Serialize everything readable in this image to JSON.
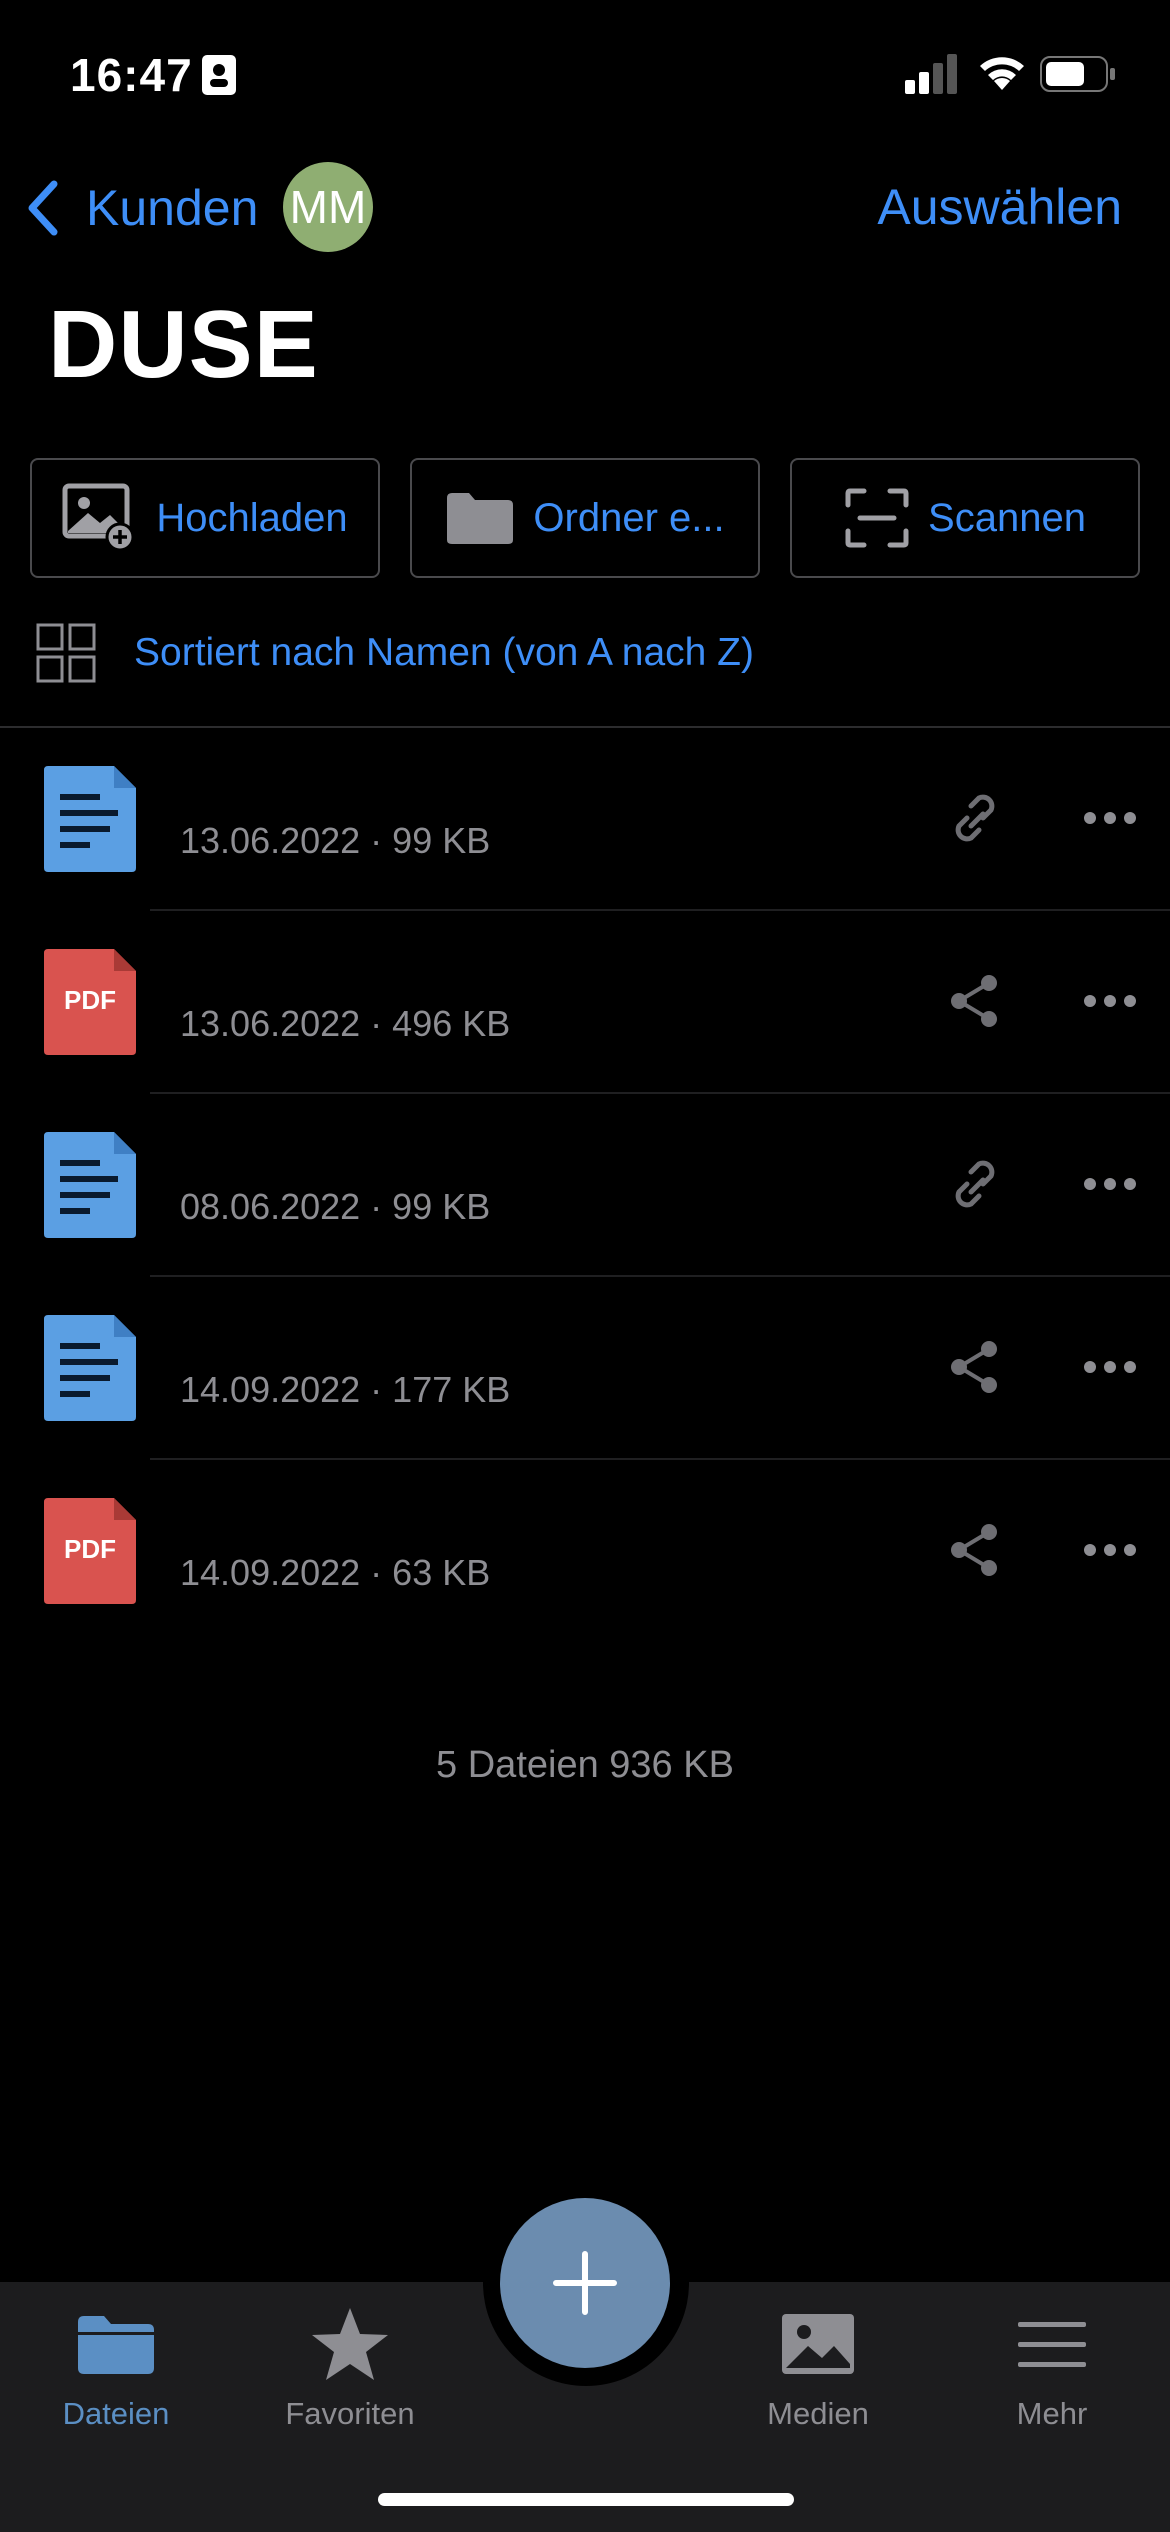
{
  "status_bar": {
    "time": "16:47"
  },
  "nav": {
    "back_label": "Kunden",
    "avatar_initials": "MM",
    "select_label": "Auswählen"
  },
  "title": "DUSE",
  "actions": {
    "upload": "Hochladen",
    "folder": "Ordner e...",
    "scan": "Scannen"
  },
  "sort_label": "Sortiert nach Namen (von A nach Z)",
  "files": [
    {
      "type": "doc",
      "name": "",
      "meta": "13.06.2022 · 99 KB",
      "action_icon": "link-icon"
    },
    {
      "type": "pdf",
      "name": "",
      "meta": "13.06.2022 · 496 KB",
      "action_icon": "share-icon",
      "icon_label": "PDF"
    },
    {
      "type": "doc",
      "name": "",
      "meta": "08.06.2022 · 99 KB",
      "action_icon": "link-icon"
    },
    {
      "type": "doc",
      "name": "",
      "meta": "14.09.2022 · 177 KB",
      "action_icon": "share-icon"
    },
    {
      "type": "pdf",
      "name": "",
      "meta": "14.09.2022 · 63 KB",
      "action_icon": "share-icon",
      "icon_label": "PDF"
    }
  ],
  "summary": "5 Dateien 936 KB",
  "tabs": {
    "files": "Dateien",
    "favorites": "Favoriten",
    "media": "Medien",
    "more": "Mehr"
  },
  "colors": {
    "accent": "#3e8ef7",
    "doc_blue": "#5b9fe3",
    "pdf_red": "#d9534f",
    "tab_active": "#5b8fc4",
    "avatar": "#8fae72"
  }
}
